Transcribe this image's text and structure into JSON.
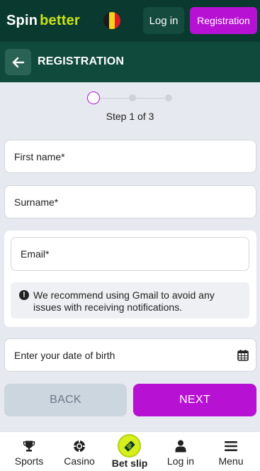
{
  "header": {
    "logo_spin": "Spin",
    "logo_better": "better",
    "login_label": "Log in",
    "register_label": "Registration",
    "flag_colors": [
      "#1a1a1a",
      "#f5d21c",
      "#e11d27"
    ]
  },
  "titlebar": {
    "title": "REGISTRATION",
    "back_icon": "arrow-left-icon"
  },
  "stepper": {
    "label": "Step 1 of 3",
    "current": 1,
    "total": 3
  },
  "form": {
    "first_name": "First name*",
    "surname": "Surname*",
    "email": "Email*",
    "notice": "We recommend using Gmail to avoid any issues with receiving notifications.",
    "notice_icon": "exclamation-circle-icon",
    "dob": "Enter your date of birth",
    "dob_icon": "calendar-icon"
  },
  "actions": {
    "back_label": "BACK",
    "next_label": "NEXT"
  },
  "bottom_nav": {
    "sports": "Sports",
    "casino": "Casino",
    "betslip": "Bet slip",
    "login": "Log in",
    "menu": "Menu"
  },
  "colors": {
    "brand_dark": "#0a3a2f",
    "accent_purple": "#b711d4",
    "accent_lime": "#d6f01e"
  }
}
